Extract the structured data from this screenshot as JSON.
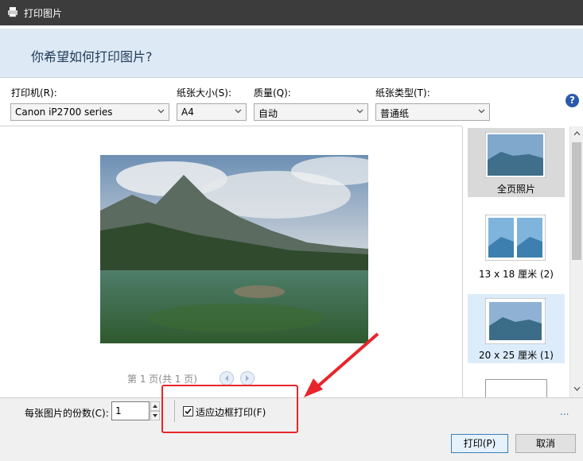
{
  "window": {
    "title": "打印图片"
  },
  "header": {
    "question": "你希望如何打印图片?"
  },
  "options": {
    "printer": {
      "label": "打印机(R):",
      "value": "Canon iP2700 series"
    },
    "paper_size": {
      "label": "纸张大小(S):",
      "value": "A4"
    },
    "quality": {
      "label": "质量(Q):",
      "value": "自动"
    },
    "paper_type": {
      "label": "纸张类型(T):",
      "value": "普通纸"
    },
    "help": "?"
  },
  "preview": {
    "page_info": "第 1 页(共 1 页)"
  },
  "layouts": [
    {
      "label": "全页照片",
      "state": "selected"
    },
    {
      "label": "13 x 18 厘米 (2)",
      "state": "normal"
    },
    {
      "label": "20 x 25 厘米 (1)",
      "state": "hover"
    }
  ],
  "footer": {
    "copies_label": "每张图片的份数(C):",
    "copies_value": "1",
    "fit_label": "适应边框打印(F)",
    "fit_checked": true,
    "more_options": "...",
    "print_button": "打印(P)",
    "cancel_button": "取消"
  },
  "colors": {
    "annotation_red": "#e8252b",
    "header_bg": "#dde9f4",
    "title_bg": "#3c3c3c"
  }
}
